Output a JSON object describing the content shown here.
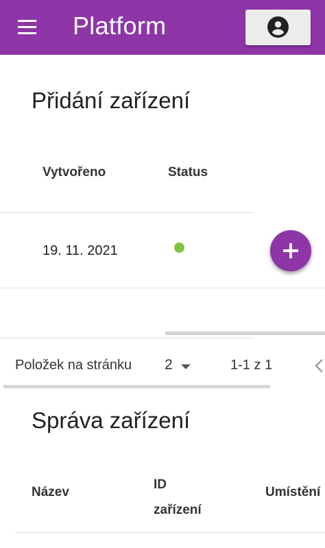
{
  "toolbar": {
    "title": "Platform",
    "menu_icon": "menu-icon",
    "account_icon": "account-circle-icon",
    "color": "#8e35a8"
  },
  "device_add": {
    "title": "Přidání zařízení",
    "columns": [
      "Vytvořeno",
      "Status"
    ],
    "rows": [
      {
        "created": "19. 11. 2021",
        "status_color": "#7cc544"
      }
    ],
    "add_icon": "add-icon"
  },
  "paginator": {
    "items_per_page_label": "Položek na stránku",
    "page_size": "2",
    "range": "1-1 z 1",
    "prev_icon": "chevron-left-icon"
  },
  "device_manage": {
    "title": "Správa zařízení",
    "columns": [
      "Název",
      "ID\nzařízení",
      "Umístění"
    ]
  }
}
